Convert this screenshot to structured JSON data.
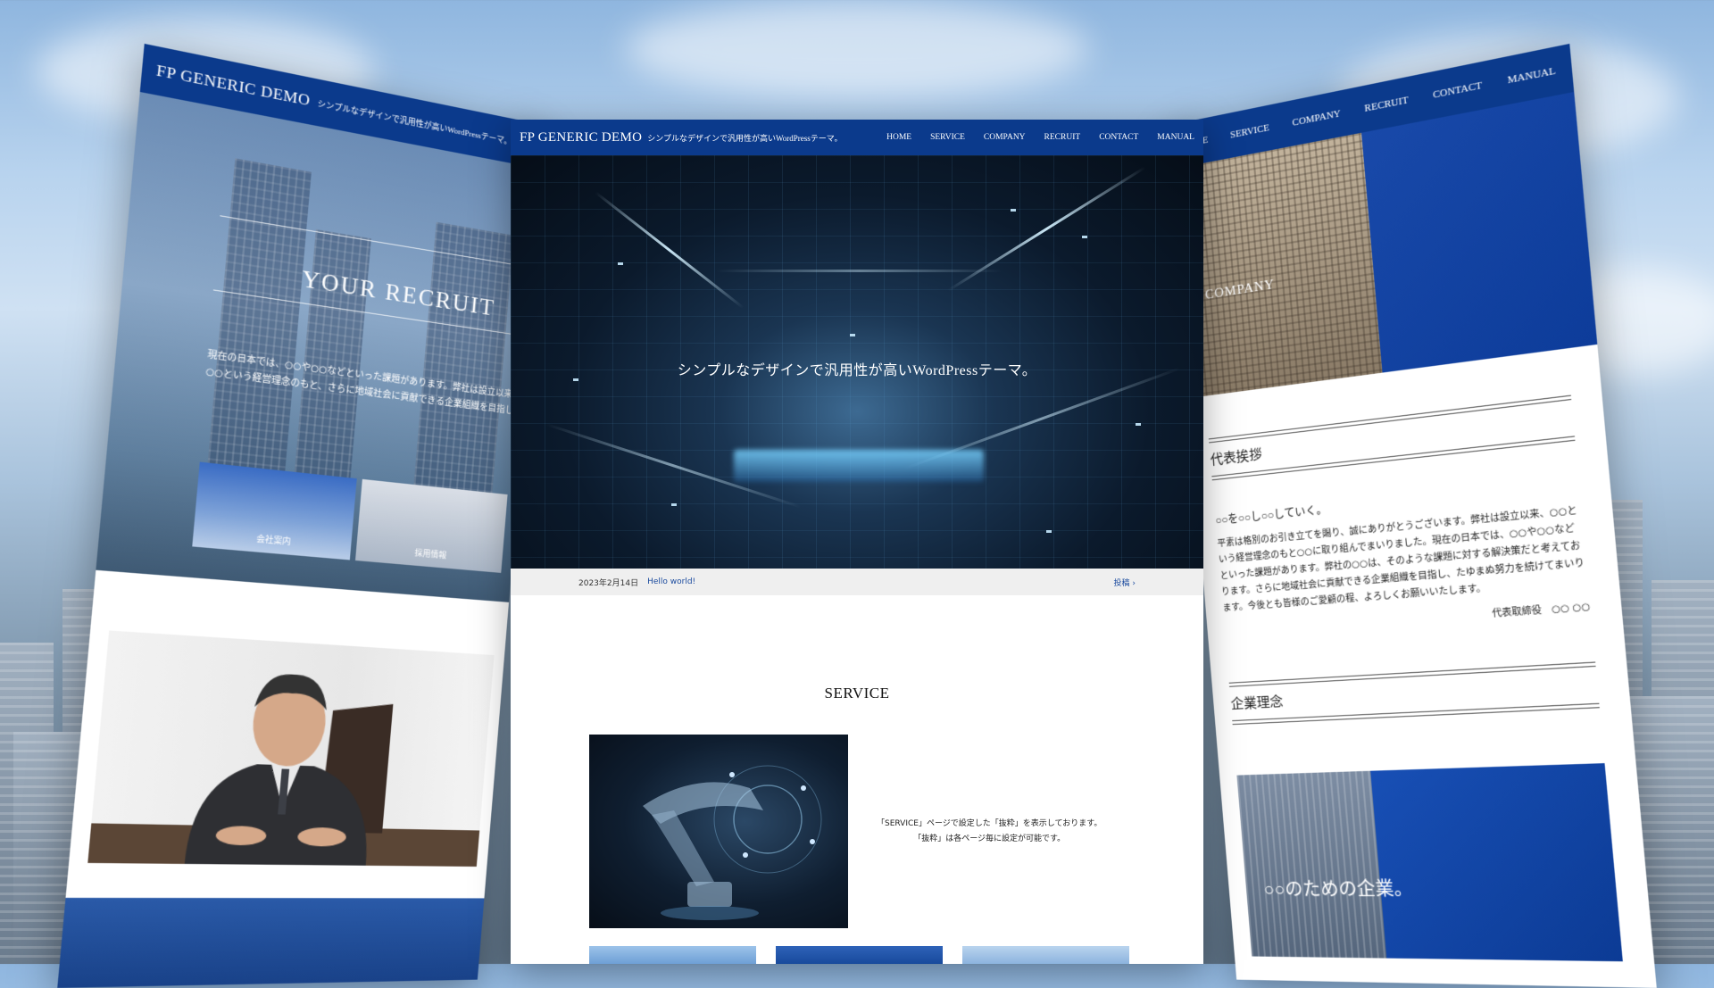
{
  "site": {
    "logo": "FP GENERIC DEMO",
    "tagline": "シンプルなデザインで汎用性が高いWordPressテーマ。"
  },
  "nav": [
    {
      "label": "HOME"
    },
    {
      "label": "SERVICE"
    },
    {
      "label": "COMPANY"
    },
    {
      "label": "RECRUIT"
    },
    {
      "label": "CONTACT"
    },
    {
      "label": "MANUAL"
    }
  ],
  "left": {
    "hero_title": "YOUR RECRUIT",
    "hero_text": "現在の日本では、○○や○○などといった課題があります。弊社は設立以来、○○という経営理念のもと、さらに地域社会に貢献できる企業組織を目指し",
    "cards": [
      {
        "label": "会社案内"
      },
      {
        "label": "採用情報"
      }
    ]
  },
  "center": {
    "hero_caption": "シンプルなデザインで汎用性が高いWordPressテーマ。",
    "news": {
      "date": "2023年2月14日",
      "title": "Hello world!",
      "more": "投稿 ›"
    },
    "section_title": "SERVICE",
    "service_text_1": "「SERVICE」ページで設定した「抜粋」を表示しております。",
    "service_text_2": "「抜粋」は各ページ毎に設定が可能です。"
  },
  "right": {
    "hero_title": "COMPANY",
    "greeting_heading": "代表挨拶",
    "lead": "○○を○○し○○していく。",
    "paragraph": "平素は格別のお引き立てを賜り、誠にありがとうございます。弊社は設立以来、○○という経営理念のもと○○に取り組んでまいりました。現在の日本では、○○や○○などといった課題があります。弊社の○○は、そのような課題に対する解決策だと考えております。さらに地域社会に貢献できる企業組織を目指し、たゆまぬ努力を続けてまいります。今後とも皆様のご愛顧の程、よろしくお願いいたします。",
    "signature": "代表取締役　○○ ○○",
    "philosophy_heading": "企業理念",
    "card_text": "○○のための企業。"
  },
  "colors": {
    "brand": "#0b3a8c",
    "link": "#1a4a9e"
  }
}
